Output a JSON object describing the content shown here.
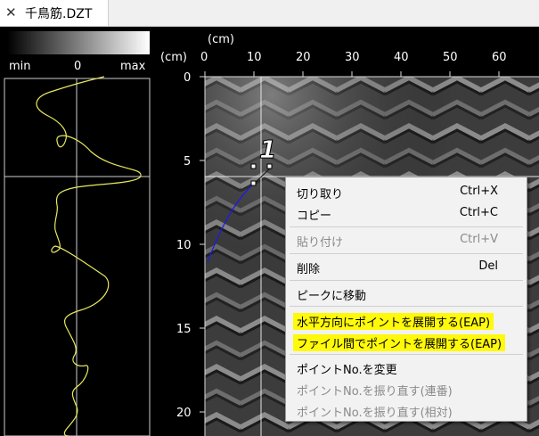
{
  "tab": {
    "title": "千鳥筋.DZT",
    "close_glyph": "✕"
  },
  "scale_bar": {
    "min_label": "min",
    "mid_label": "0",
    "max_label": "max"
  },
  "axes": {
    "x_unit": "(cm)",
    "y_unit": "(cm)",
    "x_ticks": [
      "0",
      "10",
      "20",
      "30",
      "40",
      "50",
      "60"
    ],
    "y_ticks": [
      "0",
      "5",
      "10",
      "15",
      "20"
    ]
  },
  "marker": {
    "label": "1"
  },
  "context_menu": {
    "items": [
      {
        "label": "切り取り",
        "shortcut": "Ctrl+X",
        "enabled": true
      },
      {
        "label": "コピー",
        "shortcut": "Ctrl+C",
        "enabled": true
      },
      {
        "label": "貼り付け",
        "shortcut": "Ctrl+V",
        "enabled": false
      },
      {
        "label": "削除",
        "shortcut": "Del",
        "enabled": true
      },
      {
        "label": "ピークに移動",
        "shortcut": "",
        "enabled": true
      },
      {
        "label": "水平方向にポイントを展開する(EAP)",
        "shortcut": "",
        "enabled": true,
        "highlighted": true
      },
      {
        "label": "ファイル間でポイントを展開する(EAP)",
        "shortcut": "",
        "enabled": true,
        "highlighted": true
      },
      {
        "label": "ポイントNo.を変更",
        "shortcut": "",
        "enabled": true
      },
      {
        "label": "ポイントNo.を振り直す(連番)",
        "shortcut": "",
        "enabled": false
      },
      {
        "label": "ポイントNo.を振り直す(相対)",
        "shortcut": "",
        "enabled": false
      }
    ]
  },
  "colors": {
    "trace": "#e8e860",
    "pick_line": "#1a1aee",
    "highlight": "#fff90a"
  }
}
